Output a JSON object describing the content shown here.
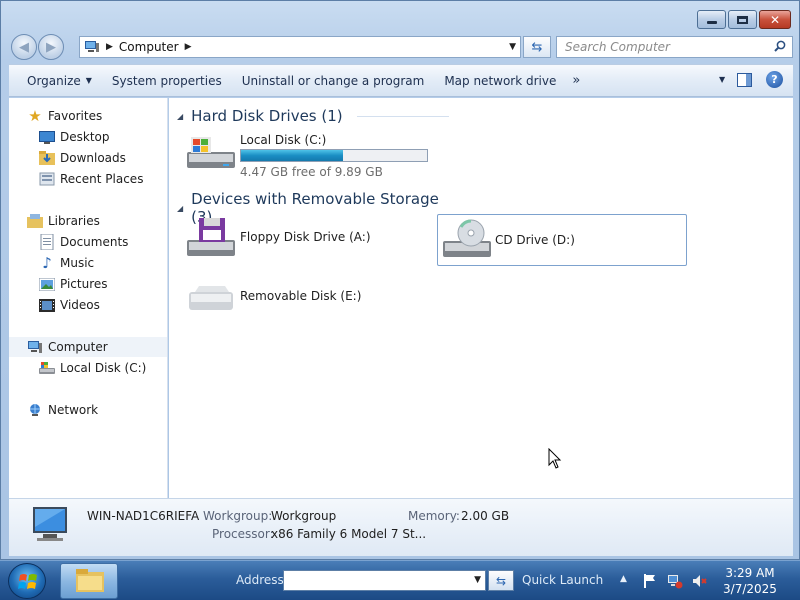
{
  "window": {
    "caption": {
      "minimize": "minimize",
      "maximize": "maximize",
      "close": "close"
    }
  },
  "address": {
    "crumb": "Computer",
    "search_placeholder": "Search Computer"
  },
  "commands": {
    "organize": "Organize",
    "system_properties": "System properties",
    "uninstall": "Uninstall or change a program",
    "map_drive": "Map network drive",
    "more": "»"
  },
  "nav": {
    "favorites": "Favorites",
    "desktop": "Desktop",
    "downloads": "Downloads",
    "recent_places": "Recent Places",
    "libraries": "Libraries",
    "documents": "Documents",
    "music": "Music",
    "pictures": "Pictures",
    "videos": "Videos",
    "computer": "Computer",
    "local_disk": "Local Disk (C:)",
    "network": "Network"
  },
  "groups": {
    "hard_disks": "Hard Disk Drives (1)",
    "removable": "Devices with Removable Storage (3)"
  },
  "drives": {
    "c": {
      "label": "Local Disk (C:)",
      "free_text": "4.47 GB free of 9.89 GB",
      "used_fraction": 0.548
    },
    "floppy": {
      "label": "Floppy Disk Drive (A:)"
    },
    "cd": {
      "label": "CD Drive (D:)"
    },
    "removable": {
      "label": "Removable Disk (E:)"
    }
  },
  "details": {
    "name": "WIN-NAD1C6RIEFA",
    "workgroup_label": "Workgroup:",
    "workgroup_value": "Workgroup",
    "memory_label": "Memory:",
    "memory_value": "2.00 GB",
    "processor_label": "Processor:",
    "processor_value": "x86 Family 6 Model 7 St..."
  },
  "taskbar": {
    "address_label": "Address",
    "quick_launch": "Quick Launch",
    "time": "3:29 AM",
    "date": "3/7/2025"
  },
  "colors": {
    "accent": "#2d67b1",
    "capacity_fill": "#1a8ec4",
    "selection_border": "#7da2ce"
  }
}
